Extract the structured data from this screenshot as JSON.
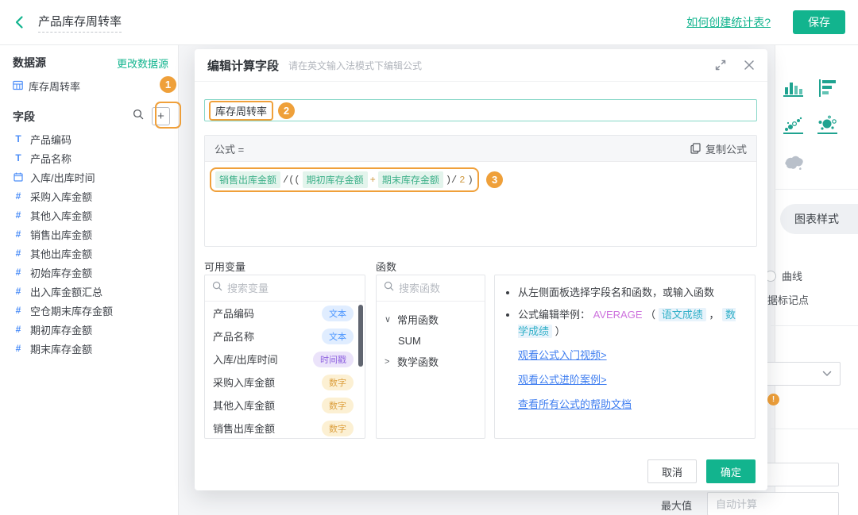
{
  "colors": {
    "accent_teal": "#12b48e",
    "annotation_orange": "#f0a03a",
    "link_blue": "#3f7ef0",
    "field_icon_blue": "#4b8df8",
    "formula_field_green": "#3db089"
  },
  "topbar": {
    "title": "产品库存周转率",
    "help_link": "如何创建统计表?",
    "save_label": "保存"
  },
  "sidebar": {
    "datasource_label": "数据源",
    "change_datasource": "更改数据源",
    "table_name": "库存周转率",
    "fields_label": "字段",
    "fields": [
      {
        "kind": "text",
        "name": "产品编码"
      },
      {
        "kind": "text",
        "name": "产品名称"
      },
      {
        "kind": "date",
        "name": "入库/出库时间"
      },
      {
        "kind": "num",
        "name": "采购入库金额"
      },
      {
        "kind": "num",
        "name": "其他入库金额"
      },
      {
        "kind": "num",
        "name": "销售出库金额"
      },
      {
        "kind": "num",
        "name": "其他出库金额"
      },
      {
        "kind": "num",
        "name": "初始库存金额"
      },
      {
        "kind": "num",
        "name": "出入库金额汇总"
      },
      {
        "kind": "num",
        "name": "空仓期末库存金额"
      },
      {
        "kind": "num",
        "name": "期初库存金额"
      },
      {
        "kind": "num",
        "name": "期末库存金额"
      }
    ]
  },
  "annotations": {
    "badge1": "1",
    "badge2": "2",
    "badge3": "3"
  },
  "modal": {
    "title": "编辑计算字段",
    "subtitle": "请在英文输入法模式下编辑公式",
    "name_value": "库存周转率",
    "formula_label": "公式 =",
    "copy_formula": "复制公式",
    "formula_tokens": [
      {
        "t": "销售出库金额",
        "k": "field"
      },
      {
        "t": "/((",
        "k": "op"
      },
      {
        "t": "期初库存金额",
        "k": "field"
      },
      {
        "t": "+",
        "k": "num"
      },
      {
        "t": "期末库存金额",
        "k": "field"
      },
      {
        "t": ")/",
        "k": "op"
      },
      {
        "t": "2",
        "k": "num"
      },
      {
        "t": ")",
        "k": "op"
      }
    ],
    "variables": {
      "label": "可用变量",
      "search_placeholder": "搜索变量",
      "items": [
        {
          "name": "产品编码",
          "badge": "文本",
          "kind": "text"
        },
        {
          "name": "产品名称",
          "badge": "文本",
          "kind": "text"
        },
        {
          "name": "入库/出库时间",
          "badge": "时间戳",
          "kind": "time"
        },
        {
          "name": "采购入库金额",
          "badge": "数字",
          "kind": "num"
        },
        {
          "name": "其他入库金额",
          "badge": "数字",
          "kind": "num"
        },
        {
          "name": "销售出库金额",
          "badge": "数字",
          "kind": "num"
        }
      ]
    },
    "functions": {
      "label": "函数",
      "search_placeholder": "搜索函数",
      "groups": [
        {
          "label": "常用函数",
          "expanded": true,
          "items": [
            "SUM"
          ]
        },
        {
          "label": "数学函数",
          "expanded": false,
          "items": []
        }
      ]
    },
    "tips": {
      "bullet1": "从左侧面板选择字段名和函数，或输入函数",
      "bullet2_prefix": "公式编辑举例：",
      "example_fn": "AVERAGE",
      "example_open": "（",
      "example_args": [
        "语文成绩",
        "数学成绩"
      ],
      "example_comma": "，",
      "example_close": "）",
      "links": [
        "观看公式入门视频>",
        "观看公式进阶案例>",
        "查看所有公式的帮助文档"
      ]
    },
    "cancel_label": "取消",
    "ok_label": "确定"
  },
  "right_panel": {
    "chart_style_tab": "图表样式",
    "curve_radio": "曲线",
    "marker_text": "据标记点",
    "max_label": "最大值",
    "max_placeholder": "自动计算"
  }
}
